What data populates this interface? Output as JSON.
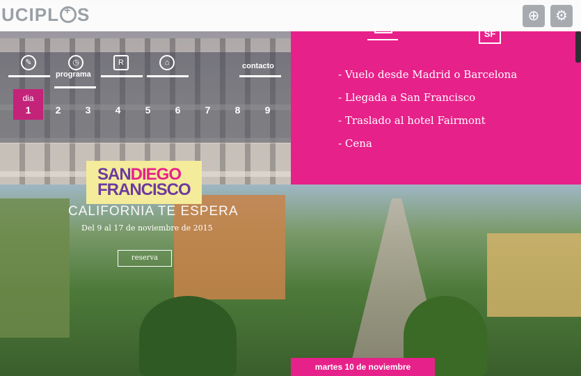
{
  "header": {
    "logo_text": "UCIPL",
    "logo_text_end": "S",
    "buttons": [
      {
        "icon": "add-user-icon",
        "glyph": "⊕"
      },
      {
        "icon": "settings-icon",
        "glyph": "⚙"
      }
    ]
  },
  "nav": {
    "items": [
      {
        "icon": "pencil-icon",
        "label": ""
      },
      {
        "icon": "clock-icon",
        "label": "programa"
      },
      {
        "icon": "restaurant-icon",
        "label": ""
      },
      {
        "icon": "home-icon",
        "label": ""
      },
      {
        "icon": "",
        "label": "contacto"
      }
    ],
    "day_word": "dia",
    "days": [
      "1",
      "2",
      "3",
      "4",
      "5",
      "6",
      "7",
      "8",
      "9"
    ],
    "active_day": "1"
  },
  "itinerary": {
    "items": [
      "- Vuelo desde Madrid o Barcelona",
      "- Llegada a San Francisco",
      "- Traslado al hotel Fairmont",
      "- Cena"
    ],
    "icons": [
      "hotel-icon",
      "sf-icon"
    ],
    "sf_text": "SF"
  },
  "promo": {
    "line1_a": "SAN",
    "line1_b": "DIEGO",
    "line2": "FRANCISCO",
    "tagline": "CALIFORNIA TE ESPERA",
    "dates": "Del 9 al 17 de noviembre de 2015",
    "cta": "reserva"
  },
  "date_bar": "martes 10 de noviembre",
  "colors": {
    "accent": "#e7218a",
    "active_day": "#c4237a",
    "promo_bg": "#f4ec9a",
    "promo_purple": "#6d3a9e"
  }
}
